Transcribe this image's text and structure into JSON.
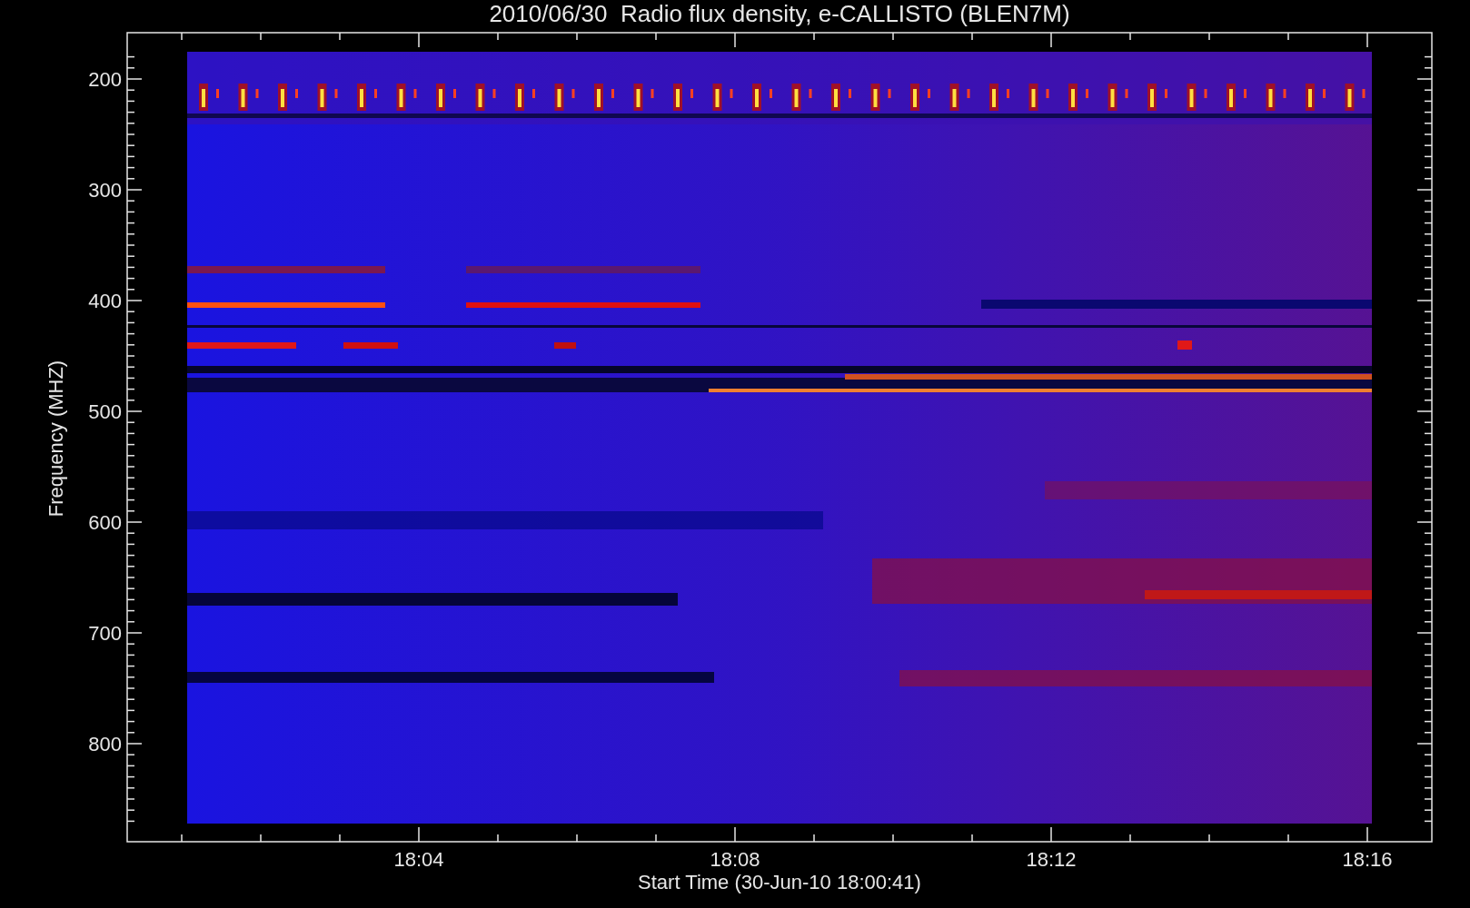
{
  "plot": {
    "title": "2010/06/30  Radio flux density, e-CALLISTO (BLEN7M)",
    "ylabel": "Frequency (MHZ)",
    "xlabel": "Start Time (30-Jun-10 18:00:41)",
    "yticks": [
      "200",
      "300",
      "400",
      "500",
      "600",
      "700",
      "800"
    ],
    "xticks": [
      "18:04",
      "18:08",
      "18:12",
      "18:16"
    ]
  }
}
